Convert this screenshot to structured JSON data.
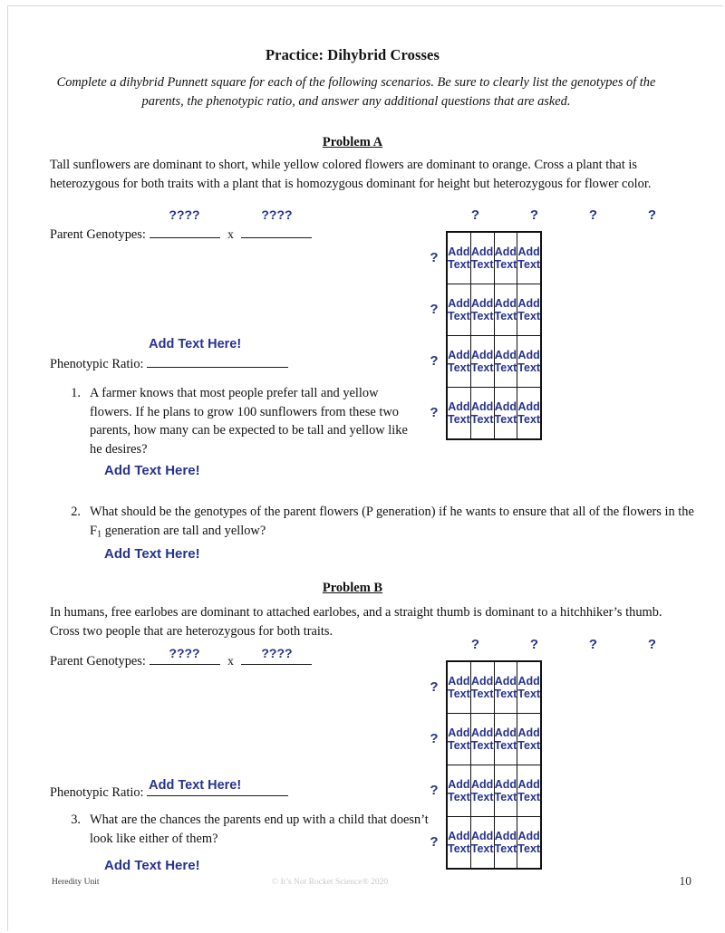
{
  "document": {
    "title": "Practice: Dihybrid Crosses",
    "subtitle": "Complete a dihybrid Punnett square for each of the following scenarios.  Be sure to clearly list the genotypes of the parents, the phenotypic ratio, and answer any additional questions that are asked."
  },
  "problem_a": {
    "heading": "Problem A",
    "scenario": "Tall sunflowers are dominant to short, while yellow colored flowers are dominant to orange.  Cross a plant that is heterozygous for both traits with a plant that is homozygous dominant for height but heterozygous for flower color.",
    "parent_label": "Parent Genotypes:",
    "parent_blank_1": "????",
    "parent_blank_2": "????",
    "cross_symbol": "x",
    "ratio_label": "Phenotypic Ratio:",
    "ratio_value": "Add Text Here!",
    "questions": [
      {
        "number": "1.",
        "text": "A farmer knows that most people prefer tall and yellow flowers.  If he plans to grow 100 sunflowers from these two parents, how many can be expected to be tall and yellow like he desires?",
        "answer": "Add Text Here!"
      },
      {
        "number": "2.",
        "text_before_sub": "What should be the genotypes of the parent flowers (P generation) if he wants to ensure that all of the flowers in the F",
        "subscript": "1",
        "text_after_sub": " generation are tall and yellow?",
        "answer": "Add Text Here!"
      }
    ],
    "punnett": {
      "column_headers": [
        "?",
        "?",
        "?",
        "?"
      ],
      "row_headers": [
        "?",
        "?",
        "?",
        "?"
      ],
      "cells": [
        [
          "Add Text",
          "Add Text",
          "Add Text",
          "Add Text"
        ],
        [
          "Add Text",
          "Add Text",
          "Add Text",
          "Add Text"
        ],
        [
          "Add Text",
          "Add Text",
          "Add Text",
          "Add Text"
        ],
        [
          "Add Text",
          "Add Text",
          "Add Text",
          "Add Text"
        ]
      ]
    }
  },
  "problem_b": {
    "heading": "Problem B",
    "scenario": "In humans, free earlobes are dominant to attached earlobes, and a straight thumb is dominant to a hitchhiker’s thumb.  Cross two people that are heterozygous for both traits.",
    "parent_label": "Parent Genotypes:",
    "parent_blank_1": "????",
    "parent_blank_2": "????",
    "cross_symbol": "x",
    "ratio_label": "Phenotypic Ratio:",
    "ratio_value": "Add Text Here!",
    "questions": [
      {
        "number": "3.",
        "text": "What are the chances the parents end up with a child that doesn’t look like either of them?",
        "answer": "Add Text Here!"
      }
    ],
    "punnett": {
      "column_headers": [
        "?",
        "?",
        "?",
        "?"
      ],
      "row_headers": [
        "?",
        "?",
        "?",
        "?"
      ],
      "cells": [
        [
          "Add Text",
          "Add Text",
          "Add Text",
          "Add Text"
        ],
        [
          "Add Text",
          "Add Text",
          "Add Text",
          "Add Text"
        ],
        [
          "Add Text",
          "Add Text",
          "Add Text",
          "Add Text"
        ],
        [
          "Add Text",
          "Add Text",
          "Add Text",
          "Add Text"
        ]
      ]
    }
  },
  "footer": {
    "left": "Heredity Unit",
    "center": "© It’s Not Rocket Science® 2020",
    "page_number": "10"
  },
  "colors": {
    "placeholder_blue": "#26338f",
    "text_black": "#111111",
    "footer_gray": "#c9c9c9"
  }
}
